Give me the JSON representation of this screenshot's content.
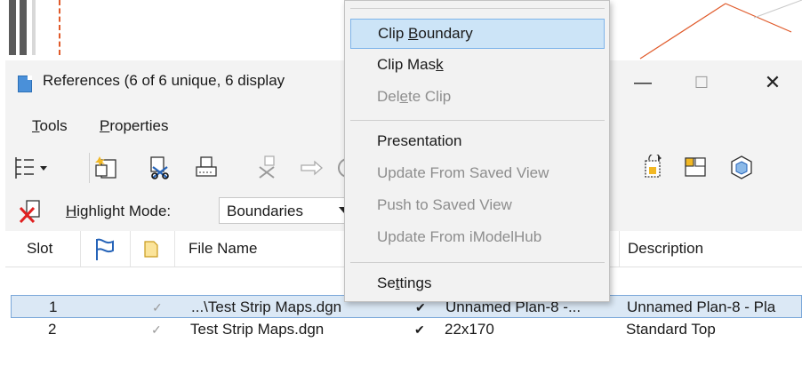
{
  "window": {
    "title": "References (6 of 6 unique, 6 display",
    "min_glyph": "—",
    "max_glyph": "☐",
    "close_glyph": "✕"
  },
  "menubar": {
    "tools": {
      "pre": "",
      "key": "T",
      "post": "ools"
    },
    "properties": {
      "pre": "",
      "key": "P",
      "post": "roperties"
    }
  },
  "highlight": {
    "label_pre": "",
    "label_key": "H",
    "label_post": "ighlight Mode:",
    "value": "Boundaries"
  },
  "table": {
    "headers": {
      "slot": "Slot",
      "file_name": "File Name",
      "description": "Description"
    },
    "rows": [
      {
        "slot": "1",
        "file": "...\\Test Strip Maps.dgn",
        "model": "Unnamed Plan-8 -...",
        "description": "Unnamed Plan-8 - Pla"
      },
      {
        "slot": "2",
        "file": "Test Strip Maps.dgn",
        "model": "22x170",
        "description": "Standard Top"
      }
    ]
  },
  "context_menu": {
    "clip_boundary": {
      "pre": "Clip ",
      "key": "B",
      "post": "oundary"
    },
    "clip_mask": {
      "pre": "Clip Mas",
      "key": "k",
      "post": ""
    },
    "delete_clip": {
      "pre": "Del",
      "key": "e",
      "post": "te Clip"
    },
    "presentation": "Presentation",
    "update_saved_view": "Update From Saved View",
    "push_saved_view": "Push to Saved View",
    "update_imodelhub": "Update From iModelHub",
    "settings": {
      "pre": "Se",
      "key": "t",
      "post": "tings"
    }
  },
  "colors": {
    "menu_highlight": "#cce4f7",
    "row_selected": "#dbe8f5",
    "disabled_text": "#8d8d8d"
  }
}
